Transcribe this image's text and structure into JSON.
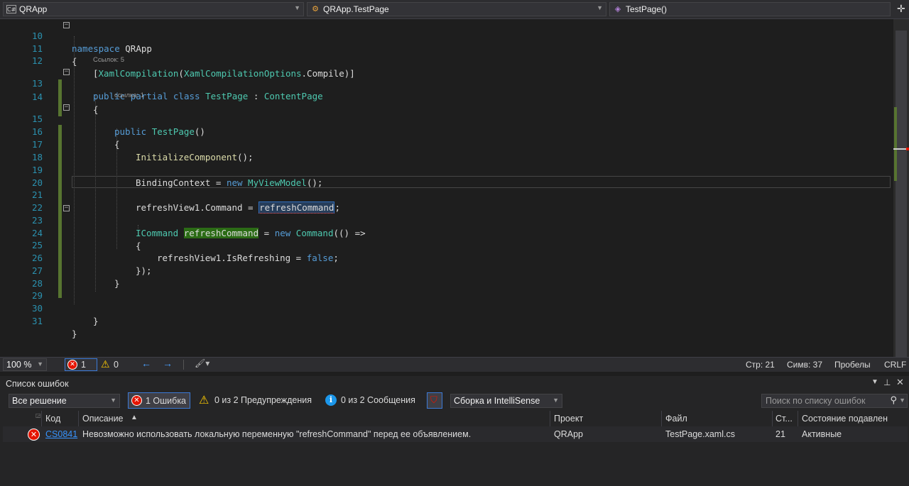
{
  "nav": {
    "project": "QRApp",
    "project_icon": "C#",
    "type": "QRApp.TestPage",
    "member": "TestPage()"
  },
  "codelens": {
    "class_refs": "Ссылок: 5",
    "ctor_refs": "ссылка: 1"
  },
  "code": {
    "lines": [
      "10",
      "11",
      "12",
      "13",
      "14",
      "15",
      "16",
      "17",
      "18",
      "19",
      "20",
      "21",
      "22",
      "23",
      "24",
      "25",
      "26",
      "27",
      "28",
      "29",
      "30",
      "31"
    ],
    "namespace_kw": "namespace",
    "namespace_name": "QRApp",
    "open_brace": "{",
    "close_brace": "}",
    "attr_open": "[",
    "attr_name": "XamlCompilation",
    "attr_paren": "(",
    "attr_arg_type": "XamlCompilationOptions",
    "attr_arg_rest": ".Compile)]",
    "public_kw": "public",
    "partial_kw": "partial",
    "class_kw": "class",
    "class_name": "TestPage",
    "colon": " : ",
    "base_class": "ContentPage",
    "ctor_name": "TestPage",
    "ctor_parens": "()",
    "init_call": "InitializeComponent",
    "init_tail": "();",
    "binding_lhs": "BindingContext = ",
    "new_kw": "new",
    "viewmodel": "MyViewModel",
    "vm_tail": "();",
    "assign_lhs": "refreshView1.Command = ",
    "assign_rhs": "refreshCommand",
    "semicolon": ";",
    "icommand": "ICommand",
    "decl_var": "refreshCommand",
    "decl_eq": " = ",
    "command_type": "Command",
    "lambda": "(() =>",
    "is_refreshing": "refreshView1.IsRefreshing = ",
    "false_kw": "false",
    "close_lambda": "});"
  },
  "status": {
    "zoom": "100 %",
    "errors": "1",
    "warnings": "0",
    "line": "Стр: 21",
    "col": "Симв: 37",
    "whitespace": "Пробелы",
    "eol": "CRLF"
  },
  "error_list": {
    "title": "Список ошибок",
    "scope": "Все решение",
    "errors_btn": "1 Ошибка",
    "warnings_btn": "0 из 2 Предупреждения",
    "messages_btn": "0 из 2 Сообщения",
    "build_filter": "Сборка и IntelliSense",
    "search_placeholder": "Поиск по списку ошибок",
    "columns": {
      "code": "Код",
      "description": "Описание",
      "project": "Проект",
      "file": "Файл",
      "line": "Ст...",
      "suppression": "Состояние подавлен"
    },
    "rows": [
      {
        "code": "CS0841",
        "description": "Невозможно использовать локальную переменную \"refreshCommand\" перед ее объявлением.",
        "project": "QRApp",
        "file": "TestPage.xaml.cs",
        "line": "21",
        "suppression": "Активные"
      }
    ]
  },
  "colors": {
    "keyword": "#569cd6",
    "type": "#4ec9b0",
    "method": "#dcdcaa",
    "line_number": "#2b91af",
    "change_bar": "#577430",
    "error_red": "#e51400",
    "link": "#3794ff"
  }
}
